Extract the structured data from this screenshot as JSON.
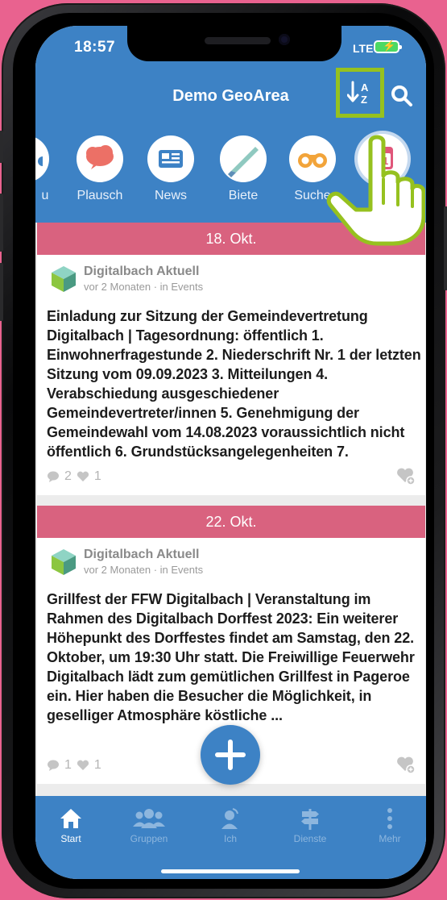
{
  "status_bar": {
    "time": "18:57",
    "network": "LTE"
  },
  "header": {
    "title": "Demo GeoArea"
  },
  "categories": [
    {
      "label": "u",
      "icon": "partial-icon"
    },
    {
      "label": "Plausch",
      "icon": "speech-bubble-icon"
    },
    {
      "label": "News",
      "icon": "newspaper-icon"
    },
    {
      "label": "Biete",
      "icon": "saw-icon"
    },
    {
      "label": "Suche",
      "icon": "binoculars-icon"
    },
    {
      "label": "31",
      "icon": "calendar-icon"
    }
  ],
  "posts": [
    {
      "date": "18. Okt.",
      "author": "Digitalbach Aktuell",
      "meta": "vor 2 Monaten · in Events",
      "text": "Einladung zur Sitzung der Gemeindevertretung Digitalbach | Tagesordnung: öffentlich 1. Einwohnerfragestunde 2. Niederschrift Nr. 1 der letzten Sitzung vom 09.09.2023 3. Mitteilungen 4. Verabschiedung ausgeschiedener Gemeindevertreter/innen 5. Genehmigung der Gemeindewahl vom 14.08.2023 voraussichtlich nicht öffentlich 6. Grundstücksangelegenheiten 7.",
      "comments": "2",
      "likes": "1"
    },
    {
      "date": "22. Okt.",
      "author": "Digitalbach Aktuell",
      "meta": "vor 2 Monaten · in Events",
      "text": "Grillfest der FFW Digitalbach | Veranstaltung im Rahmen des Digitalbach Dorffest 2023: Ein weiterer Höhepunkt des Dorffestes findet am Samstag, den 22. Oktober, um 19:30 Uhr statt. Die Freiwillige Feuerwehr Digitalbach  lädt zum gemütlichen Grillfest in Pageroe ein. Hier haben die Besucher die Möglichkeit, in geselliger Atmosphäre köstliche ...",
      "comments": "1",
      "likes": "1"
    }
  ],
  "tabs": [
    {
      "label": "Start",
      "icon": "home-icon",
      "active": true
    },
    {
      "label": "Gruppen",
      "icon": "group-icon",
      "active": false
    },
    {
      "label": "Ich",
      "icon": "person-icon",
      "active": false
    },
    {
      "label": "Dienste",
      "icon": "signpost-icon",
      "active": false
    },
    {
      "label": "Mehr",
      "icon": "more-icon",
      "active": false
    }
  ],
  "colors": {
    "primary": "#3d82c5",
    "date_bar": "#d9627f",
    "highlight": "#96c11f",
    "background": "#e9628f"
  }
}
